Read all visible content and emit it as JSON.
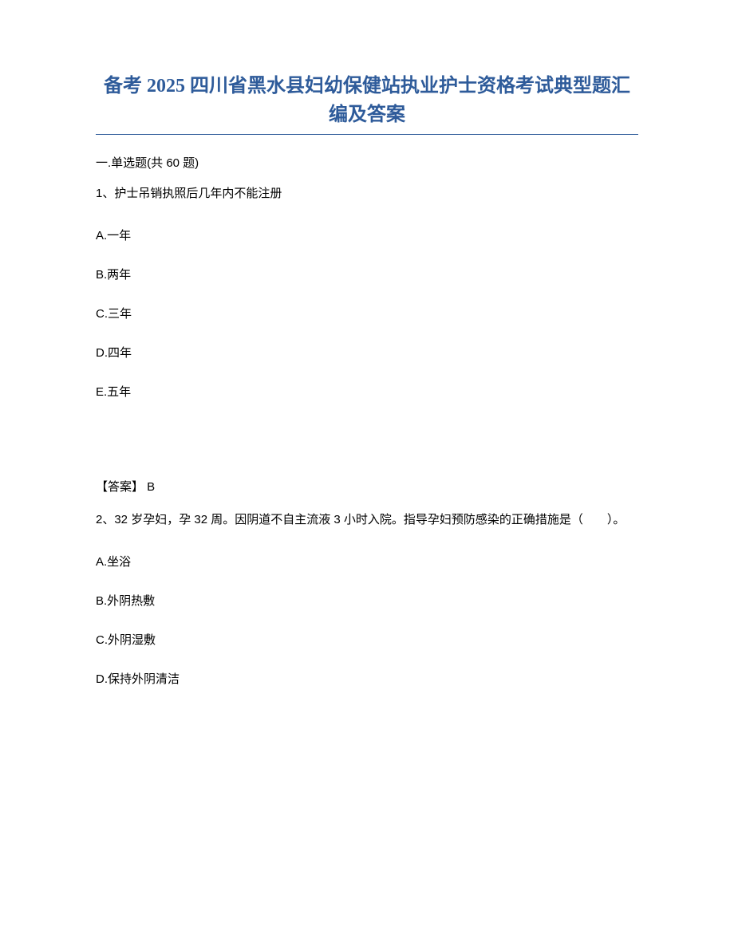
{
  "title": "备考 2025 四川省黑水县妇幼保健站执业护士资格考试典型题汇编及答案",
  "section": "一.单选题(共 60 题)",
  "q1": {
    "stem": "1、护士吊销执照后几年内不能注册",
    "A": "A.一年",
    "B": "B.两年",
    "C": "C.三年",
    "D": "D.四年",
    "E": "E.五年",
    "answer": "【答案】 B"
  },
  "q2": {
    "stem": "2、32 岁孕妇，孕 32 周。因阴道不自主流液 3 小时入院。指导孕妇预防感染的正确措施是（　　）。",
    "A": "A.坐浴",
    "B": "B.外阴热敷",
    "C": "C.外阴湿敷",
    "D": "D.保持外阴清洁"
  }
}
